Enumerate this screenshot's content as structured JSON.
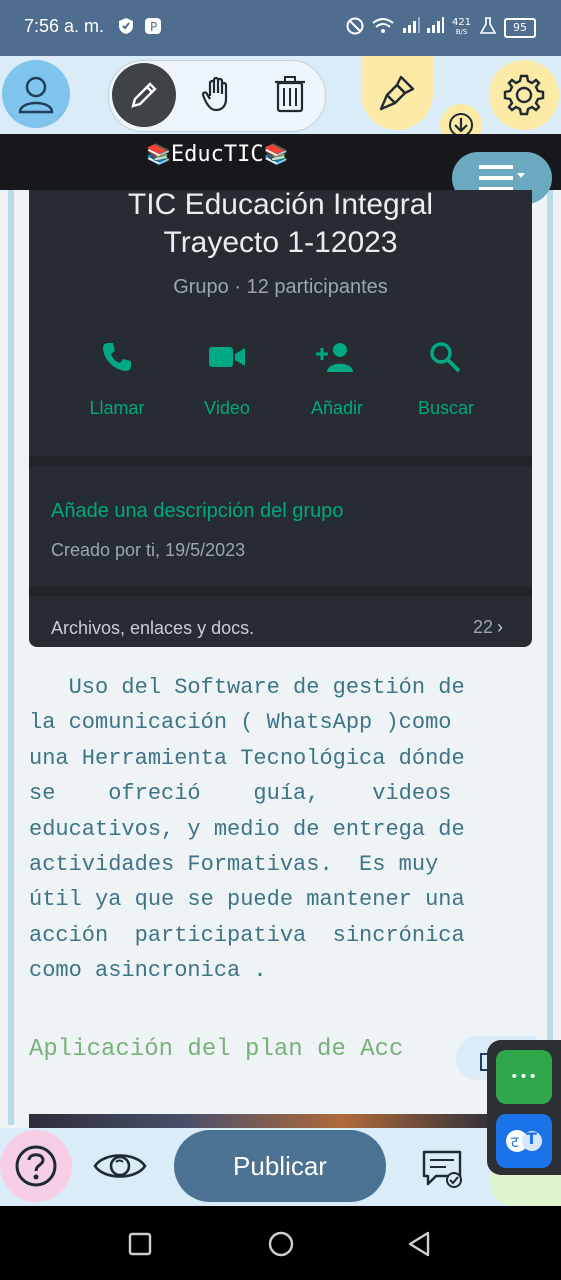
{
  "status_bar": {
    "time": "7:56 a. m.",
    "network_speed": "421",
    "network_unit": "B/S",
    "battery": "95"
  },
  "toolbar": {
    "items": [
      "profile-icon",
      "pencil-icon",
      "hand-icon",
      "trash-icon",
      "brush-icon",
      "gear-icon",
      "download-icon",
      "menu-icon"
    ]
  },
  "brand": {
    "title": "EducTIC"
  },
  "whatsapp": {
    "group_name_line1": "TIC  Educación Integral",
    "group_name_line2": "Trayecto 1-12023",
    "subtitle": "Grupo · 12 participantes",
    "actions": [
      "Llamar",
      "Video",
      "Añadir",
      "Buscar"
    ],
    "description_prompt": "Añade una descripción del grupo",
    "created": "Creado por ti, 19/5/2023",
    "files_label": "Archivos, enlaces y docs.",
    "files_count": "22"
  },
  "content": {
    "lines": [
      "   Uso del Software de gestión de",
      "la comunicación ( WhatsApp )como",
      "una Herramienta Tecnológica dónde",
      "se    ofreció    guía,    videos",
      "educativos, y medio de entrega de",
      "actividades Formativas.  Es muy",
      "útil ya que se puede mantener una",
      "acción  participativa  sincrónica",
      "como asincronica ."
    ],
    "heading2": "Aplicación del plan de Acc"
  },
  "bottom_nav": {
    "publish_label": "Publicar"
  },
  "floating_panel": {
    "dots": "•••",
    "translate_label": "T"
  },
  "colors": {
    "accent_blue": "#4b7193",
    "whatsapp_green": "#00a884",
    "highlight_yellow": "#fbe9a6"
  }
}
